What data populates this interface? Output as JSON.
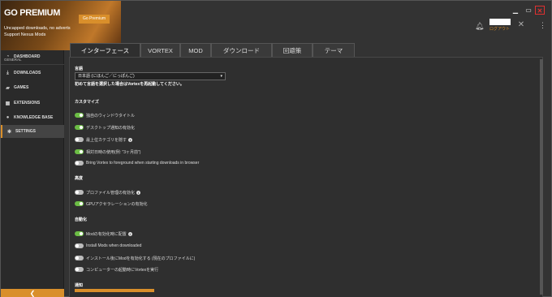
{
  "banner": {
    "title": "GO PREMIUM",
    "line1": "Uncapped downloads, no adverts",
    "line2": "Support Nexus Mods",
    "button": "Go Premium"
  },
  "window": {
    "minimize": "▁",
    "maximize": "▭",
    "close": "✕"
  },
  "user": {
    "logout": "ログアウト"
  },
  "sidebar": {
    "items": [
      {
        "label": "DASHBOARD",
        "icon": "◔"
      },
      {
        "label": "DOWNLOADS",
        "icon": "⤓"
      },
      {
        "label": "GAMES",
        "icon": "▰"
      },
      {
        "label": "EXTENSIONS",
        "icon": "▦"
      },
      {
        "label": "KNOWLEDGE BASE",
        "icon": "●"
      },
      {
        "label": "SETTINGS",
        "icon": "✱"
      }
    ],
    "section_general": "GENERAL",
    "collapse": "❮"
  },
  "tabs": [
    "インターフェース",
    "VORTEX",
    "MOD",
    "ダウンロード",
    "回避策",
    "テーマ"
  ],
  "settings": {
    "language_label": "言語",
    "language_value": "日本語 (にほんご／にっぽんご)",
    "language_note": "初めて言語を選択した場合はVortexを再起動してください。",
    "customize_heading": "カスタマイズ",
    "customize": [
      {
        "label": "独自のウィンドウタイトル",
        "on": true
      },
      {
        "label": "デスクトップ通知の有効化",
        "on": true
      },
      {
        "label": "最上位カテゴリを隠す",
        "on": false,
        "info": true
      },
      {
        "label": "相対日時の使用(例: \"3ヶ月前\")",
        "on": true
      },
      {
        "label": "Bring Vortex to foreground when starting downloads in browser",
        "on": false
      }
    ],
    "advanced_heading": "高度",
    "advanced": [
      {
        "label": "プロファイル管理の有効化",
        "on": false,
        "info": true
      },
      {
        "label": "GPUアクセラレーションの有効化",
        "on": true
      }
    ],
    "auto_heading": "自動化",
    "auto": [
      {
        "label": "Modの有効化時に配置",
        "on": true,
        "info": true
      },
      {
        "label": "Install Mods when downloaded",
        "on": false
      },
      {
        "label": "インストール後にModを有効化する (現在のプロファイルに)",
        "on": false
      },
      {
        "label": "コンピューターの起動時にVortexを実行",
        "on": false
      }
    ],
    "notify_heading": "通知"
  },
  "colors": {
    "accent": "#d98f2b",
    "toggle_on": "#6cbd45"
  }
}
